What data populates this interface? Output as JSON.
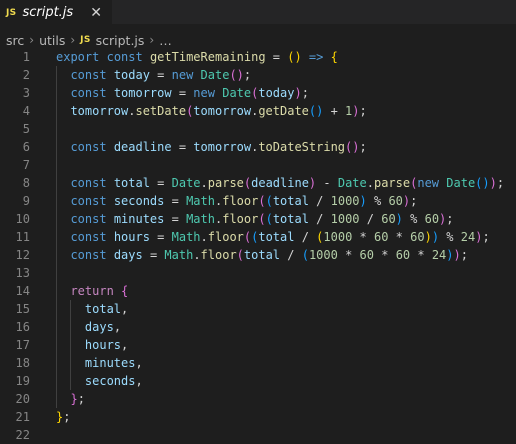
{
  "tab": {
    "icon": "JS",
    "title": "script.js",
    "close_glyph": "✕"
  },
  "breadcrumb": {
    "items": [
      "src",
      "utils"
    ],
    "file_icon": "JS",
    "file": "script.js",
    "more": "…"
  },
  "editor": {
    "language": "javascript",
    "lines": [
      {
        "n": "1",
        "code": [
          [
            "kw",
            "export"
          ],
          [
            "op",
            " "
          ],
          [
            "kw",
            "const"
          ],
          [
            "op",
            " "
          ],
          [
            "fn",
            "getTimeRemaining"
          ],
          [
            "op",
            " = "
          ],
          [
            "p1",
            "()"
          ],
          [
            "op",
            " "
          ],
          [
            "kw",
            "=>"
          ],
          [
            "op",
            " "
          ],
          [
            "p1",
            "{"
          ]
        ]
      },
      {
        "n": "2",
        "code": [
          [
            "op",
            "  "
          ],
          [
            "kw",
            "const"
          ],
          [
            "op",
            " "
          ],
          [
            "var",
            "today"
          ],
          [
            "op",
            " = "
          ],
          [
            "kw",
            "new"
          ],
          [
            "op",
            " "
          ],
          [
            "cls",
            "Date"
          ],
          [
            "p2",
            "()"
          ],
          [
            "op",
            ";"
          ]
        ]
      },
      {
        "n": "3",
        "code": [
          [
            "op",
            "  "
          ],
          [
            "kw",
            "const"
          ],
          [
            "op",
            " "
          ],
          [
            "var",
            "tomorrow"
          ],
          [
            "op",
            " = "
          ],
          [
            "kw",
            "new"
          ],
          [
            "op",
            " "
          ],
          [
            "cls",
            "Date"
          ],
          [
            "p2",
            "("
          ],
          [
            "var",
            "today"
          ],
          [
            "p2",
            ")"
          ],
          [
            "op",
            ";"
          ]
        ]
      },
      {
        "n": "4",
        "code": [
          [
            "op",
            "  "
          ],
          [
            "var",
            "tomorrow"
          ],
          [
            "op",
            "."
          ],
          [
            "fn",
            "setDate"
          ],
          [
            "p2",
            "("
          ],
          [
            "var",
            "tomorrow"
          ],
          [
            "op",
            "."
          ],
          [
            "fn",
            "getDate"
          ],
          [
            "p3",
            "()"
          ],
          [
            "op",
            " + "
          ],
          [
            "num",
            "1"
          ],
          [
            "p2",
            ")"
          ],
          [
            "op",
            ";"
          ]
        ]
      },
      {
        "n": "5",
        "code": []
      },
      {
        "n": "6",
        "code": [
          [
            "op",
            "  "
          ],
          [
            "kw",
            "const"
          ],
          [
            "op",
            " "
          ],
          [
            "var",
            "deadline"
          ],
          [
            "op",
            " = "
          ],
          [
            "var",
            "tomorrow"
          ],
          [
            "op",
            "."
          ],
          [
            "fn",
            "toDateString"
          ],
          [
            "p2",
            "()"
          ],
          [
            "op",
            ";"
          ]
        ]
      },
      {
        "n": "7",
        "code": []
      },
      {
        "n": "8",
        "code": [
          [
            "op",
            "  "
          ],
          [
            "kw",
            "const"
          ],
          [
            "op",
            " "
          ],
          [
            "var",
            "total"
          ],
          [
            "op",
            " = "
          ],
          [
            "cls",
            "Date"
          ],
          [
            "op",
            "."
          ],
          [
            "fn",
            "parse"
          ],
          [
            "p2",
            "("
          ],
          [
            "var",
            "deadline"
          ],
          [
            "p2",
            ")"
          ],
          [
            "op",
            " - "
          ],
          [
            "cls",
            "Date"
          ],
          [
            "op",
            "."
          ],
          [
            "fn",
            "parse"
          ],
          [
            "p2",
            "("
          ],
          [
            "kw",
            "new"
          ],
          [
            "op",
            " "
          ],
          [
            "cls",
            "Date"
          ],
          [
            "p3",
            "()"
          ],
          [
            "p2",
            ")"
          ],
          [
            "op",
            ";"
          ]
        ]
      },
      {
        "n": "9",
        "code": [
          [
            "op",
            "  "
          ],
          [
            "kw",
            "const"
          ],
          [
            "op",
            " "
          ],
          [
            "var",
            "seconds"
          ],
          [
            "op",
            " = "
          ],
          [
            "cls",
            "Math"
          ],
          [
            "op",
            "."
          ],
          [
            "fn",
            "floor"
          ],
          [
            "p2",
            "("
          ],
          [
            "p3",
            "("
          ],
          [
            "var",
            "total"
          ],
          [
            "op",
            " / "
          ],
          [
            "num",
            "1000"
          ],
          [
            "p3",
            ")"
          ],
          [
            "op",
            " % "
          ],
          [
            "num",
            "60"
          ],
          [
            "p2",
            ")"
          ],
          [
            "op",
            ";"
          ]
        ]
      },
      {
        "n": "10",
        "code": [
          [
            "op",
            "  "
          ],
          [
            "kw",
            "const"
          ],
          [
            "op",
            " "
          ],
          [
            "var",
            "minutes"
          ],
          [
            "op",
            " = "
          ],
          [
            "cls",
            "Math"
          ],
          [
            "op",
            "."
          ],
          [
            "fn",
            "floor"
          ],
          [
            "p2",
            "("
          ],
          [
            "p3",
            "("
          ],
          [
            "var",
            "total"
          ],
          [
            "op",
            " / "
          ],
          [
            "num",
            "1000"
          ],
          [
            "op",
            " / "
          ],
          [
            "num",
            "60"
          ],
          [
            "p3",
            ")"
          ],
          [
            "op",
            " % "
          ],
          [
            "num",
            "60"
          ],
          [
            "p2",
            ")"
          ],
          [
            "op",
            ";"
          ]
        ]
      },
      {
        "n": "11",
        "code": [
          [
            "op",
            "  "
          ],
          [
            "kw",
            "const"
          ],
          [
            "op",
            " "
          ],
          [
            "var",
            "hours"
          ],
          [
            "op",
            " = "
          ],
          [
            "cls",
            "Math"
          ],
          [
            "op",
            "."
          ],
          [
            "fn",
            "floor"
          ],
          [
            "p2",
            "("
          ],
          [
            "p3",
            "("
          ],
          [
            "var",
            "total"
          ],
          [
            "op",
            " / "
          ],
          [
            "p1",
            "("
          ],
          [
            "num",
            "1000"
          ],
          [
            "op",
            " * "
          ],
          [
            "num",
            "60"
          ],
          [
            "op",
            " * "
          ],
          [
            "num",
            "60"
          ],
          [
            "p1",
            ")"
          ],
          [
            "p3",
            ")"
          ],
          [
            "op",
            " % "
          ],
          [
            "num",
            "24"
          ],
          [
            "p2",
            ")"
          ],
          [
            "op",
            ";"
          ]
        ]
      },
      {
        "n": "12",
        "code": [
          [
            "op",
            "  "
          ],
          [
            "kw",
            "const"
          ],
          [
            "op",
            " "
          ],
          [
            "var",
            "days"
          ],
          [
            "op",
            " = "
          ],
          [
            "cls",
            "Math"
          ],
          [
            "op",
            "."
          ],
          [
            "fn",
            "floor"
          ],
          [
            "p2",
            "("
          ],
          [
            "var",
            "total"
          ],
          [
            "op",
            " / "
          ],
          [
            "p3",
            "("
          ],
          [
            "num",
            "1000"
          ],
          [
            "op",
            " * "
          ],
          [
            "num",
            "60"
          ],
          [
            "op",
            " * "
          ],
          [
            "num",
            "60"
          ],
          [
            "op",
            " * "
          ],
          [
            "num",
            "24"
          ],
          [
            "p3",
            ")"
          ],
          [
            "p2",
            ")"
          ],
          [
            "op",
            ";"
          ]
        ]
      },
      {
        "n": "13",
        "code": []
      },
      {
        "n": "14",
        "code": [
          [
            "op",
            "  "
          ],
          [
            "ctl",
            "return"
          ],
          [
            "op",
            " "
          ],
          [
            "p2",
            "{"
          ]
        ]
      },
      {
        "n": "15",
        "code": [
          [
            "op",
            "    "
          ],
          [
            "var",
            "total"
          ],
          [
            "op",
            ","
          ]
        ]
      },
      {
        "n": "16",
        "code": [
          [
            "op",
            "    "
          ],
          [
            "var",
            "days"
          ],
          [
            "op",
            ","
          ]
        ]
      },
      {
        "n": "17",
        "code": [
          [
            "op",
            "    "
          ],
          [
            "var",
            "hours"
          ],
          [
            "op",
            ","
          ]
        ]
      },
      {
        "n": "18",
        "code": [
          [
            "op",
            "    "
          ],
          [
            "var",
            "minutes"
          ],
          [
            "op",
            ","
          ]
        ]
      },
      {
        "n": "19",
        "code": [
          [
            "op",
            "    "
          ],
          [
            "var",
            "seconds"
          ],
          [
            "op",
            ","
          ]
        ]
      },
      {
        "n": "20",
        "code": [
          [
            "op",
            "  "
          ],
          [
            "p2",
            "}"
          ],
          [
            "op",
            ";"
          ]
        ]
      },
      {
        "n": "21",
        "code": [
          [
            "p1",
            "}"
          ],
          [
            "op",
            ";"
          ]
        ]
      },
      {
        "n": "22",
        "code": []
      }
    ]
  },
  "colors": {
    "background": "#1e1e1e",
    "tabbar": "#252526",
    "keyword": "#569cd6",
    "control": "#c586c0",
    "function": "#dcdcaa",
    "variable": "#9cdcfe",
    "class": "#4ec9b0",
    "number": "#b5cea8",
    "bracket1": "#ffd700",
    "bracket2": "#da70d6",
    "bracket3": "#179fff"
  }
}
